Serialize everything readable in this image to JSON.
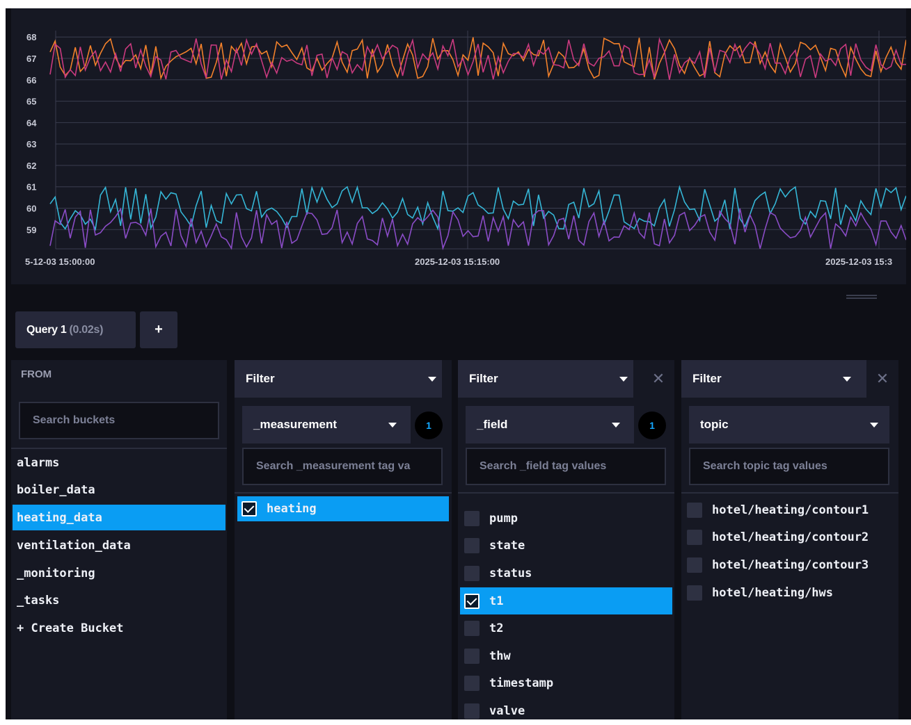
{
  "chart_data": {
    "type": "line",
    "y_ticks": [
      "68",
      "67",
      "66",
      "65",
      "64",
      "63",
      "62",
      "61",
      "60",
      "59"
    ],
    "ylim": [
      58.1,
      68.3
    ],
    "x_ticks": [
      "5-12-03 15:00:00",
      "2025-12-03 15:15:00",
      "2025-12-03 15:3"
    ],
    "series": [
      {
        "color": "#f2812b",
        "band": [
          66.0,
          68.0
        ]
      },
      {
        "color": "#c93a7f",
        "band": [
          66.0,
          68.0
        ]
      },
      {
        "color": "#35b6d6",
        "band": [
          59.0,
          61.0
        ]
      },
      {
        "color": "#8a4cc6",
        "band": [
          58.1,
          60.0
        ]
      }
    ],
    "grid": true
  },
  "query": {
    "tab_label": "Query 1",
    "tab_time": "(0.02s)",
    "add_label": "+"
  },
  "from": {
    "title": "FROM",
    "search_placeholder": "Search buckets",
    "buckets": [
      "alarms",
      "boiler_data",
      "heating_data",
      "ventilation_data",
      "_monitoring",
      "_tasks",
      "+ Create Bucket"
    ],
    "selected": "heating_data"
  },
  "filters": [
    {
      "header": "Filter",
      "key": "_measurement",
      "count": "1",
      "search_placeholder": "Search _measurement tag va",
      "values": [
        {
          "label": "heating",
          "checked": true
        }
      ]
    },
    {
      "header": "Filter",
      "key": "_field",
      "count": "1",
      "search_placeholder": "Search _field tag values",
      "values": [
        {
          "label": "pump",
          "checked": false
        },
        {
          "label": "state",
          "checked": false
        },
        {
          "label": "status",
          "checked": false
        },
        {
          "label": "t1",
          "checked": true
        },
        {
          "label": "t2",
          "checked": false
        },
        {
          "label": "thw",
          "checked": false
        },
        {
          "label": "timestamp",
          "checked": false
        },
        {
          "label": "valve",
          "checked": false
        }
      ]
    },
    {
      "header": "Filter",
      "key": "topic",
      "count": "",
      "search_placeholder": "Search topic tag values",
      "values": [
        {
          "label": "hotel/heating/contour1",
          "checked": false
        },
        {
          "label": "hotel/heating/contour2",
          "checked": false
        },
        {
          "label": "hotel/heating/contour3",
          "checked": false
        },
        {
          "label": "hotel/heating/hws",
          "checked": false
        }
      ]
    }
  ],
  "icons": {
    "dropdown": "chevron-down-icon",
    "close": "close-icon",
    "check": "check-icon"
  }
}
